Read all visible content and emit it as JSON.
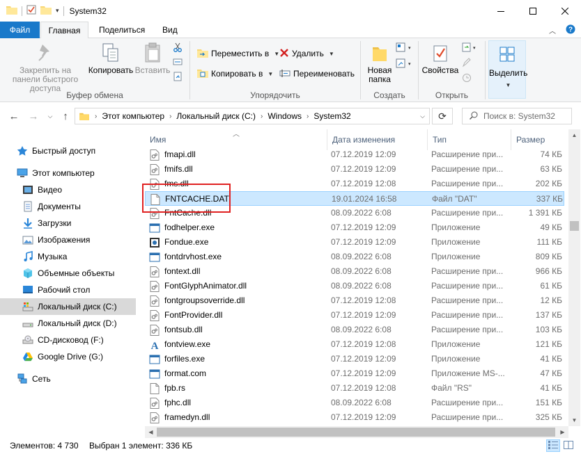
{
  "window": {
    "title": "System32"
  },
  "tabs": [
    {
      "label": "Файл"
    },
    {
      "label": "Главная"
    },
    {
      "label": "Поделиться"
    },
    {
      "label": "Вид"
    }
  ],
  "ribbon": {
    "clipboard": {
      "pin_label": "Закрепить на панели быстрого доступа",
      "copy_label": "Копировать",
      "paste_label": "Вставить",
      "group_label": "Буфер обмена"
    },
    "organize": {
      "move_label": "Переместить в",
      "copy_to_label": "Копировать в",
      "delete_label": "Удалить",
      "rename_label": "Переименовать",
      "group_label": "Упорядочить"
    },
    "create": {
      "new_folder_label": "Новая папка",
      "group_label": "Создать"
    },
    "open": {
      "properties_label": "Свойства",
      "group_label": "Открыть"
    },
    "select": {
      "select_label": "Выделить"
    }
  },
  "address": {
    "crumbs": [
      "Этот компьютер",
      "Локальный диск (C:)",
      "Windows",
      "System32"
    ],
    "search_placeholder": "Поиск в: System32"
  },
  "nav": {
    "items": [
      {
        "label": "Быстрый доступ",
        "icon": "star-icon"
      },
      {
        "label": "Этот компьютер",
        "icon": "computer-icon"
      },
      {
        "label": "Видео",
        "icon": "video-icon"
      },
      {
        "label": "Документы",
        "icon": "documents-icon"
      },
      {
        "label": "Загрузки",
        "icon": "downloads-icon"
      },
      {
        "label": "Изображения",
        "icon": "pictures-icon"
      },
      {
        "label": "Музыка",
        "icon": "music-icon"
      },
      {
        "label": "Объемные объекты",
        "icon": "3d-objects-icon"
      },
      {
        "label": "Рабочий стол",
        "icon": "desktop-icon"
      },
      {
        "label": "Локальный диск (C:)",
        "icon": "drive-c-icon"
      },
      {
        "label": "Локальный диск (D:)",
        "icon": "drive-d-icon"
      },
      {
        "label": "CD-дисковод (F:)",
        "icon": "cd-drive-icon"
      },
      {
        "label": "Google Drive (G:)",
        "icon": "google-drive-icon"
      },
      {
        "label": "Сеть",
        "icon": "network-icon"
      }
    ]
  },
  "columns": {
    "name": "Имя",
    "date": "Дата изменения",
    "type": "Тип",
    "size": "Размер"
  },
  "files": [
    {
      "name": "fmapi.dll",
      "date": "07.12.2019 12:09",
      "type": "Расширение при...",
      "size": "74 КБ",
      "icon": "dll-file-icon"
    },
    {
      "name": "fmifs.dll",
      "date": "07.12.2019 12:09",
      "type": "Расширение при...",
      "size": "63 КБ",
      "icon": "dll-file-icon"
    },
    {
      "name": "fms.dll",
      "date": "07.12.2019 12:08",
      "type": "Расширение при...",
      "size": "202 КБ",
      "icon": "dll-file-icon"
    },
    {
      "name": "FNTCACHE.DAT",
      "date": "19.01.2024 16:58",
      "type": "Файл \"DAT\"",
      "size": "337 КБ",
      "icon": "dat-file-icon"
    },
    {
      "name": "FntCache.dll",
      "date": "08.09.2022 6:08",
      "type": "Расширение при...",
      "size": "1 391 КБ",
      "icon": "dll-file-icon"
    },
    {
      "name": "fodhelper.exe",
      "date": "07.12.2019 12:09",
      "type": "Приложение",
      "size": "49 КБ",
      "icon": "exe-file-icon"
    },
    {
      "name": "Fondue.exe",
      "date": "07.12.2019 12:09",
      "type": "Приложение",
      "size": "111 КБ",
      "icon": "exe-fondue-icon"
    },
    {
      "name": "fontdrvhost.exe",
      "date": "08.09.2022 6:08",
      "type": "Приложение",
      "size": "809 КБ",
      "icon": "exe-file-icon"
    },
    {
      "name": "fontext.dll",
      "date": "08.09.2022 6:08",
      "type": "Расширение при...",
      "size": "966 КБ",
      "icon": "dll-file-icon"
    },
    {
      "name": "FontGlyphAnimator.dll",
      "date": "08.09.2022 6:08",
      "type": "Расширение при...",
      "size": "61 КБ",
      "icon": "dll-file-icon"
    },
    {
      "name": "fontgroupsoverride.dll",
      "date": "07.12.2019 12:08",
      "type": "Расширение при...",
      "size": "12 КБ",
      "icon": "dll-file-icon"
    },
    {
      "name": "FontProvider.dll",
      "date": "07.12.2019 12:09",
      "type": "Расширение при...",
      "size": "137 КБ",
      "icon": "dll-file-icon"
    },
    {
      "name": "fontsub.dll",
      "date": "08.09.2022 6:08",
      "type": "Расширение при...",
      "size": "103 КБ",
      "icon": "dll-file-icon"
    },
    {
      "name": "fontview.exe",
      "date": "07.12.2019 12:08",
      "type": "Приложение",
      "size": "121 КБ",
      "icon": "fontview-icon"
    },
    {
      "name": "forfiles.exe",
      "date": "07.12.2019 12:09",
      "type": "Приложение",
      "size": "41 КБ",
      "icon": "exe-file-icon"
    },
    {
      "name": "format.com",
      "date": "07.12.2019 12:09",
      "type": "Приложение MS-...",
      "size": "47 КБ",
      "icon": "exe-file-icon"
    },
    {
      "name": "fpb.rs",
      "date": "07.12.2019 12:08",
      "type": "Файл \"RS\"",
      "size": "41 КБ",
      "icon": "generic-file-icon"
    },
    {
      "name": "fphc.dll",
      "date": "08.09.2022 6:08",
      "type": "Расширение при...",
      "size": "151 КБ",
      "icon": "dll-file-icon"
    },
    {
      "name": "framedyn.dll",
      "date": "07.12.2019 12:09",
      "type": "Расширение при...",
      "size": "325 КБ",
      "icon": "dll-file-icon"
    }
  ],
  "selected_index": 3,
  "status": {
    "count": "Элементов: 4 730",
    "selection": "Выбран 1 элемент: 336 КБ"
  }
}
